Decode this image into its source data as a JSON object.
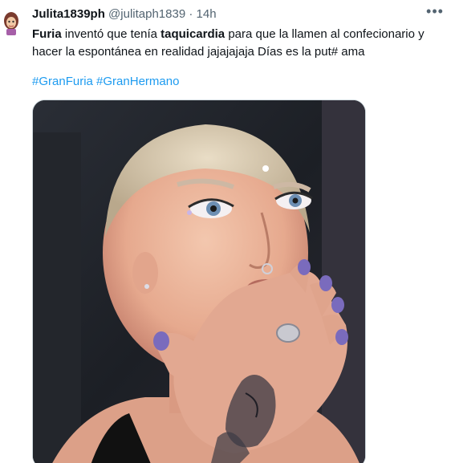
{
  "tweet": {
    "display_name": "Julita1839ph",
    "handle": "@julitaph1839",
    "separator": "·",
    "time": "14h",
    "more_label": "•••",
    "text": {
      "seg1_bold": "Furia",
      "seg2": " inventó que tenía ",
      "seg3_bold": "taquicardia",
      "seg4": " para que la llamen al confecionario y hacer la espontánea en realidad jajajajaja Días es la put# ama"
    },
    "hashtags": [
      "#GranFuria",
      "#GranHermano"
    ],
    "colors": {
      "link": "#1d9bf0",
      "secondary": "#536471",
      "primary": "#0f1419"
    }
  }
}
